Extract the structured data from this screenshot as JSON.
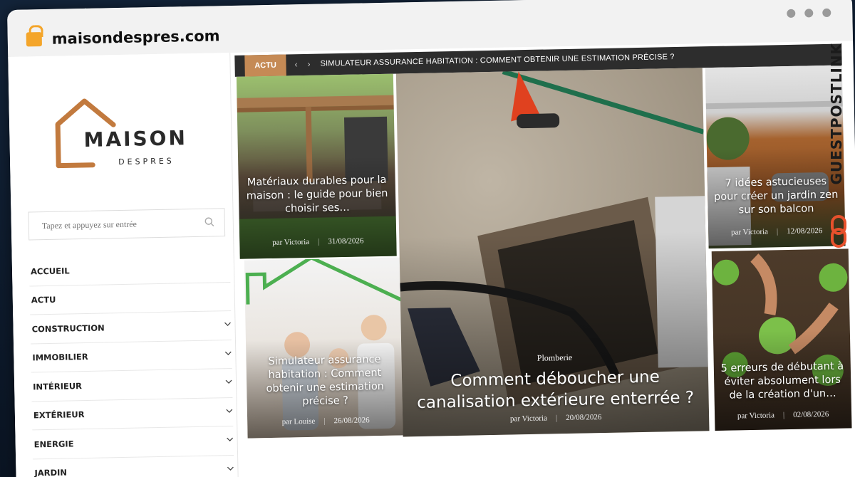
{
  "browser": {
    "url": "maisondespres.com"
  },
  "sidebar": {
    "logo": {
      "name": "MAISON",
      "sub": "DESPRES"
    },
    "search": {
      "placeholder": "Tapez et appuyez sur entrée"
    },
    "menu": [
      {
        "label": "ACCUEIL",
        "has_submenu": false
      },
      {
        "label": "ACTU",
        "has_submenu": false
      },
      {
        "label": "CONSTRUCTION",
        "has_submenu": true
      },
      {
        "label": "IMMOBILIER",
        "has_submenu": true
      },
      {
        "label": "INTÉRIEUR",
        "has_submenu": true
      },
      {
        "label": "EXTÉRIEUR",
        "has_submenu": true
      },
      {
        "label": "ENERGIE",
        "has_submenu": true
      },
      {
        "label": "JARDIN",
        "has_submenu": true
      }
    ]
  },
  "ticker": {
    "label": "ACTU",
    "prev": "‹",
    "next": "›",
    "headline": "SIMULATEUR ASSURANCE HABITATION : COMMENT OBTENIR UNE ESTIMATION PRÉCISE ?"
  },
  "cards": {
    "pergola": {
      "title": "Matériaux durables pour la maison : le guide pour bien choisir ses…",
      "author": "par Victoria",
      "date": "31/08/2026"
    },
    "family": {
      "title": "Simulateur assurance habitation : Comment obtenir une estimation précise ?",
      "author": "par Louise",
      "date": "26/08/2026"
    },
    "featured": {
      "category": "Plomberie",
      "title": "Comment déboucher une canalisation extérieure enterrée ?",
      "author": "par Victoria",
      "date": "20/08/2026"
    },
    "balcony": {
      "title": "7 idées astucieuses pour créer un jardin zen sur son balcon",
      "author": "par Victoria",
      "date": "12/08/2026"
    },
    "garden": {
      "title": "5 erreurs de débutant à éviter absolument lors de la création d'un…",
      "author": "par Victoria",
      "date": "02/08/2026"
    }
  },
  "brand_overlay": "GUESTPOSTLINK",
  "colors": {
    "accent": "#c58a55",
    "logo_orange": "#c27a3e",
    "ticker_bg": "#2d2d2d",
    "lock": "#f4a52a",
    "brand_red": "#e8512c"
  }
}
